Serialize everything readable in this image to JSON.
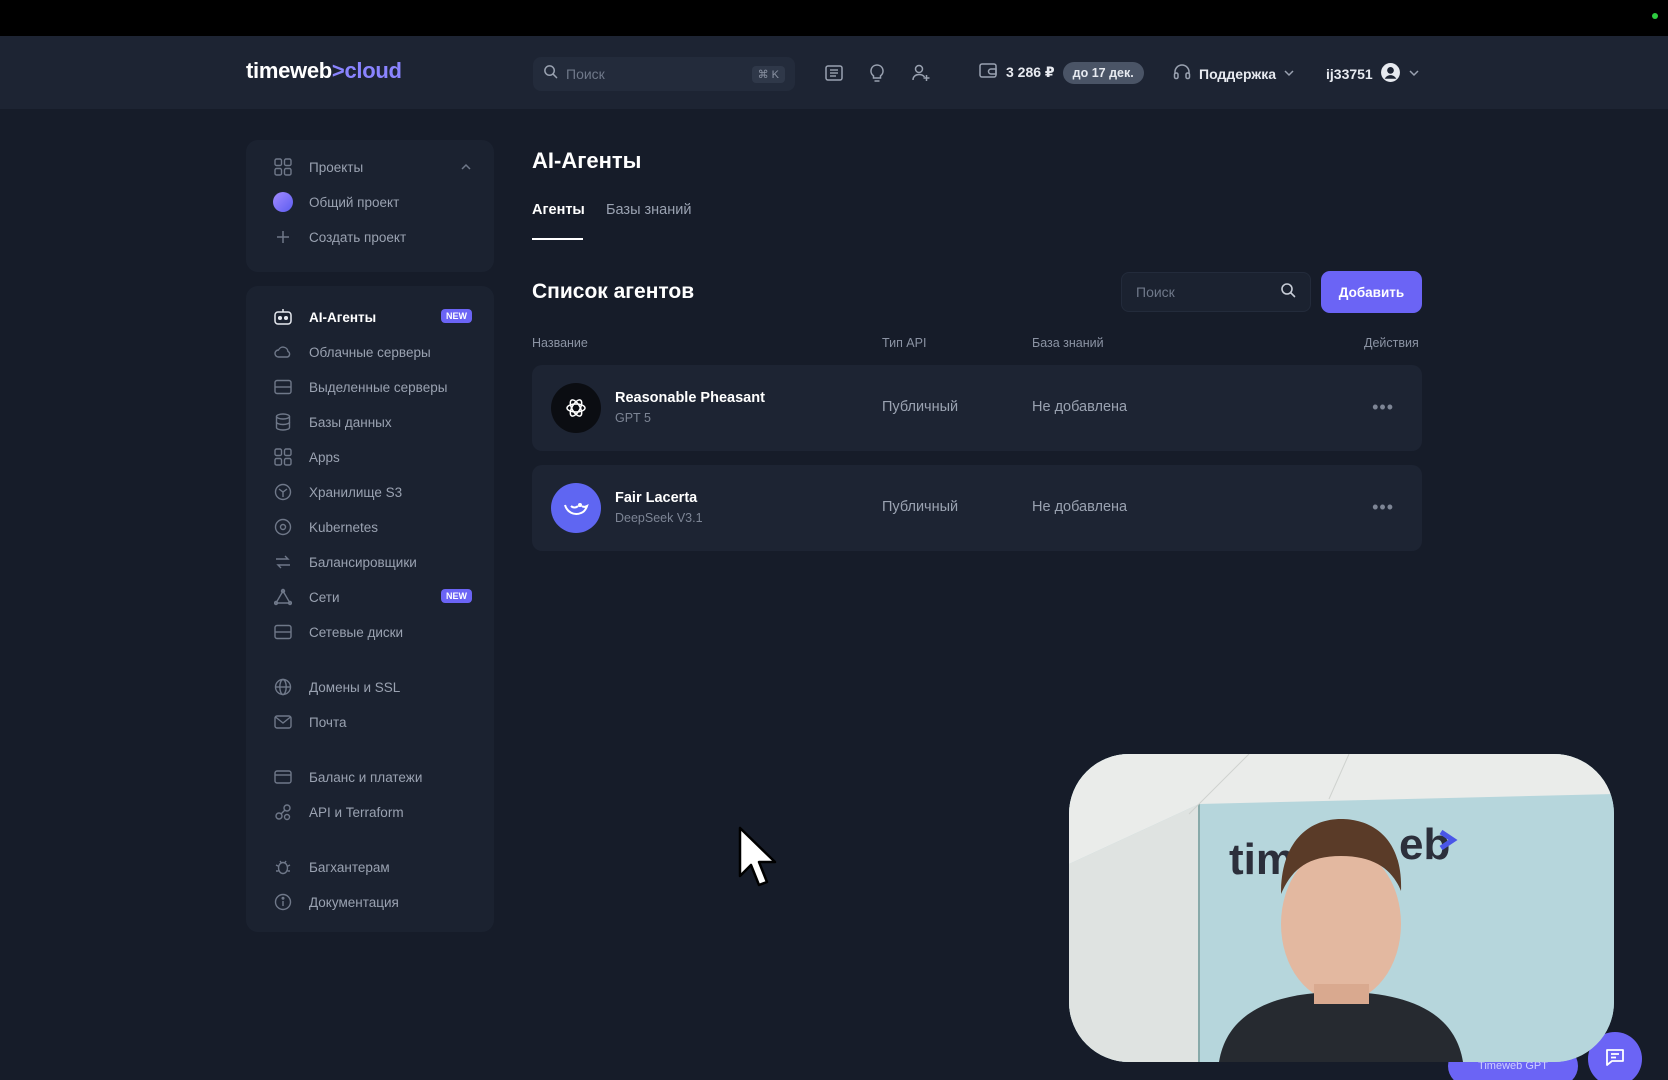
{
  "header": {
    "logo_part1": "timeweb",
    "logo_sep": ">",
    "logo_part2": "cloud",
    "search_placeholder": "Поиск",
    "search_shortcut": "⌘ K",
    "balance": "3 286 ₽",
    "balance_until": "до 17 дек.",
    "support": "Поддержка",
    "username": "ij33751"
  },
  "sidebar": {
    "projects": [
      {
        "label": "Проекты",
        "icon": "grid-icon"
      },
      {
        "label": "Общий проект",
        "icon": "project-dot-icon"
      },
      {
        "label": "Создать проект",
        "icon": "plus-icon"
      }
    ],
    "items": [
      {
        "label": "AI-Агенты",
        "icon": "robot-icon",
        "badge": "NEW"
      },
      {
        "label": "Облачные серверы",
        "icon": "cloud-icon"
      },
      {
        "label": "Выделенные серверы",
        "icon": "server-icon"
      },
      {
        "label": "Базы данных",
        "icon": "database-icon"
      },
      {
        "label": "Apps",
        "icon": "apps-icon"
      },
      {
        "label": "Хранилище S3",
        "icon": "storage-icon"
      },
      {
        "label": "Kubernetes",
        "icon": "kubernetes-icon"
      },
      {
        "label": "Балансировщики",
        "icon": "balancer-icon"
      },
      {
        "label": "Сети",
        "icon": "network-icon",
        "badge": "NEW"
      },
      {
        "label": "Сетевые диски",
        "icon": "disk-icon"
      },
      {
        "label": "Домены и SSL",
        "icon": "globe-icon"
      },
      {
        "label": "Почта",
        "icon": "mail-icon"
      },
      {
        "label": "Баланс и платежи",
        "icon": "wallet-icon"
      },
      {
        "label": "API и Terraform",
        "icon": "api-icon"
      },
      {
        "label": "Багхантерам",
        "icon": "bug-icon"
      },
      {
        "label": "Документация",
        "icon": "info-icon"
      }
    ]
  },
  "main": {
    "title": "AI-Агенты",
    "tabs": [
      {
        "label": "Агенты"
      },
      {
        "label": "Базы знаний"
      }
    ],
    "list_title": "Список агентов",
    "search_placeholder": "Поиск",
    "add_button": "Добавить",
    "columns": {
      "name": "Название",
      "api_type": "Тип API",
      "knowledge_base": "База знаний",
      "actions": "Действия"
    },
    "agents": [
      {
        "name": "Reasonable Pheasant",
        "model": "GPT 5",
        "api_type": "Публичный",
        "knowledge_base": "Не добавлена",
        "avatar": "openai-icon",
        "avatar_color": "#0b0d12"
      },
      {
        "name": "Fair Lacerta",
        "model": "DeepSeek V3.1",
        "api_type": "Публичный",
        "knowledge_base": "Не добавлена",
        "avatar": "deepseek-whale-icon",
        "avatar_color": "#5f66f2"
      }
    ]
  },
  "widget": {
    "chat_label": "Timeweb GPT"
  },
  "colors": {
    "accent": "#6b64f5",
    "background": "#161c29",
    "header": "#1d2433",
    "panel": "#1b2230"
  }
}
